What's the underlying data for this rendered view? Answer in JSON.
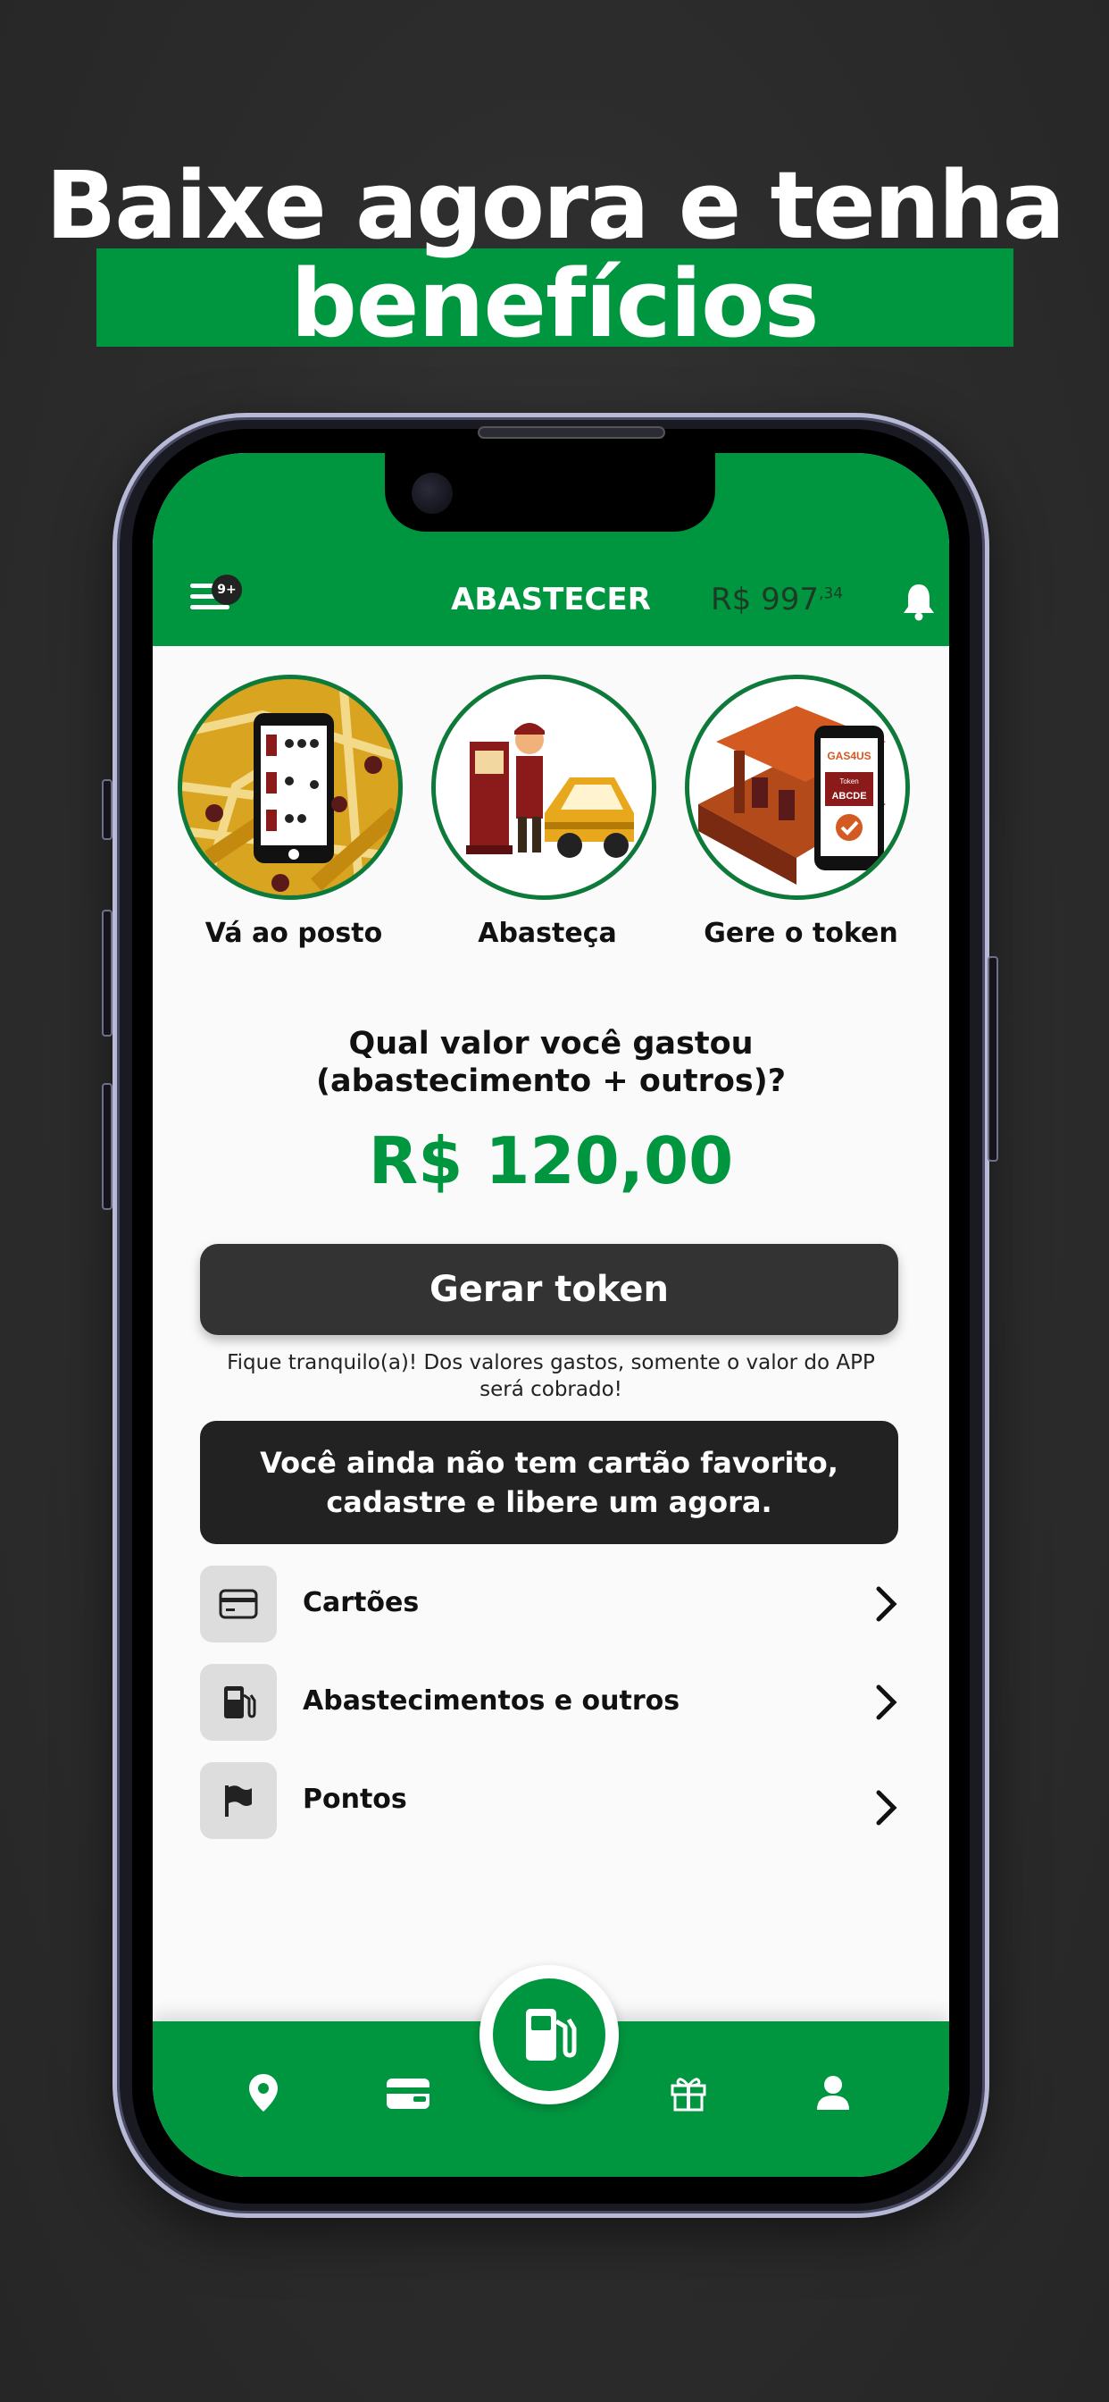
{
  "headline": {
    "line1": "Baixe agora e tenha",
    "line2": "benefícios"
  },
  "app_bar": {
    "menu_badge": "9+",
    "title": "ABASTECER",
    "balance_main": "R$ 997",
    "balance_cents": ",34"
  },
  "steps": [
    {
      "label": "Vá ao posto",
      "icon": "map-phone-illustration"
    },
    {
      "label": "Abasteça",
      "icon": "gas-attendant-car-illustration"
    },
    {
      "label": "Gere o token",
      "icon": "gas-station-token-illustration",
      "brand_text": "GAS4US",
      "token_title": "Token",
      "token_code": "ABCDE"
    }
  ],
  "question": {
    "line1": "Qual valor você gastou",
    "line2": "(abastecimento + outros)?"
  },
  "amount": "R$ 120,00",
  "token_button": "Gerar token",
  "note": "Fique tranquilo(a)! Dos valores gastos, somente o valor do APP será cobrado!",
  "favorite_card_message": {
    "line1": "Você ainda não tem cartão favorito,",
    "line2": "cadastre e libere um agora."
  },
  "menu": [
    {
      "label": "Cartões",
      "icon": "credit-card-icon"
    },
    {
      "label": "Abastecimentos e outros",
      "icon": "fuel-pump-icon"
    },
    {
      "label": "Pontos",
      "icon": "flag-icon"
    }
  ],
  "bottom_nav": [
    "location-pin-icon",
    "wallet-icon",
    "fuel-pump-icon",
    "gift-icon",
    "user-icon"
  ],
  "colors": {
    "brand_green": "#009640",
    "dark_button": "#333333",
    "background": "#2c2c2c"
  }
}
